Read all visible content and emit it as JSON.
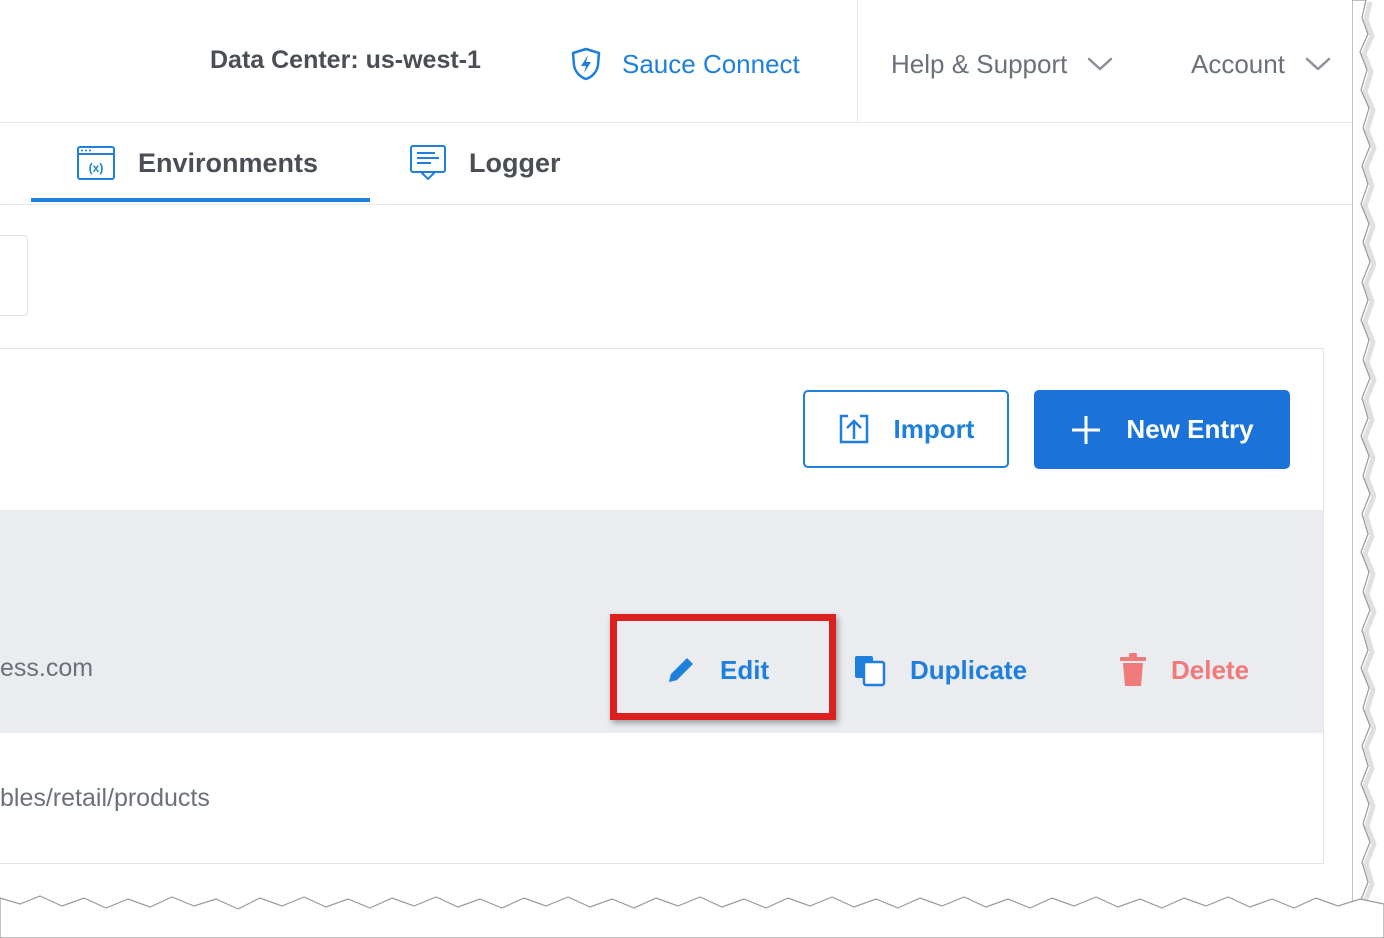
{
  "header": {
    "data_center": "Data Center: us-west-1",
    "sauce_connect": "Sauce Connect",
    "help_support": "Help & Support",
    "account": "Account"
  },
  "tabs": [
    {
      "label": "Environments",
      "active": true
    },
    {
      "label": "Logger",
      "active": false
    }
  ],
  "toolbar": {
    "import_label": "Import",
    "new_entry_label": "New Entry"
  },
  "rows": [
    {
      "value": "ess.com",
      "highlighted": true
    },
    {
      "value": "bles/retail/products",
      "highlighted": false
    }
  ],
  "row_actions": {
    "edit": "Edit",
    "duplicate": "Duplicate",
    "delete": "Delete"
  },
  "colors": {
    "accent": "#1e7fdc",
    "primary_button": "#1b73d9",
    "danger": "#f07a7a",
    "highlight_box": "#dc1f1f",
    "row_highlight": "#ebecf0"
  },
  "icons": {
    "sauce_connect": "shield-bolt-icon",
    "dropdown": "chevron-down-icon",
    "environments": "variable-window-icon",
    "logger": "log-board-icon",
    "import": "upload-icon",
    "new_entry": "plus-icon",
    "edit": "pencil-icon",
    "duplicate": "copy-icon",
    "delete": "trash-icon"
  }
}
